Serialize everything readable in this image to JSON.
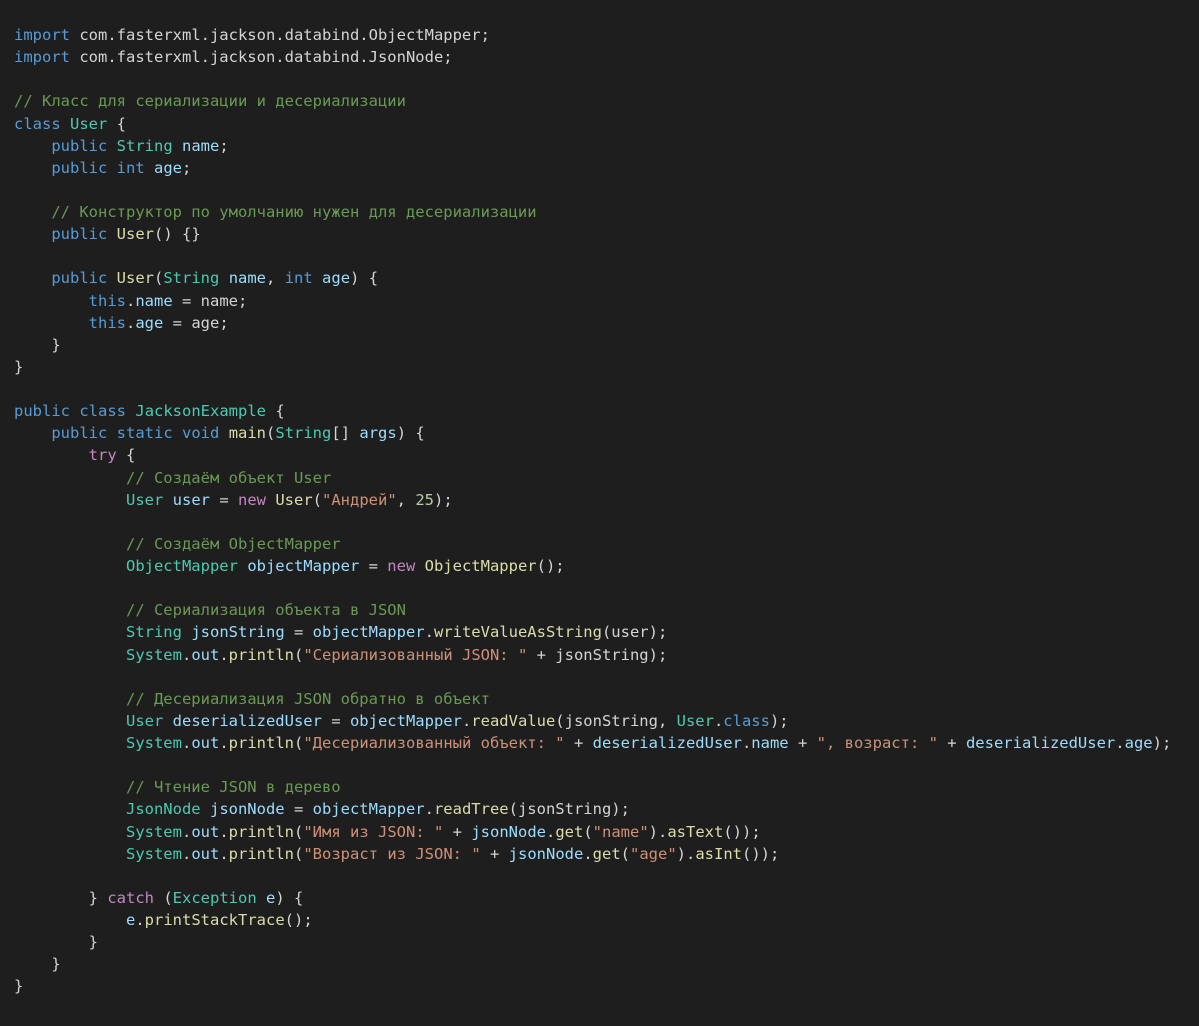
{
  "colors": {
    "background": "#1e1e1e",
    "kw": "#569cd6",
    "ctrl": "#c586c0",
    "type": "#4ec9b0",
    "var": "#9cdcfe",
    "fn": "#dcdcaa",
    "str": "#ce9178",
    "num": "#b5cea8",
    "cmt": "#6a9955",
    "plain": "#d4d4d4"
  },
  "code_lines": [
    [
      [
        "kw",
        "import"
      ],
      [
        "plain",
        " com.fasterxml.jackson.databind.ObjectMapper;"
      ]
    ],
    [
      [
        "kw",
        "import"
      ],
      [
        "plain",
        " com.fasterxml.jackson.databind.JsonNode;"
      ]
    ],
    [],
    [
      [
        "cmt",
        "// Класс для сериализации и десериализации"
      ]
    ],
    [
      [
        "kw",
        "class"
      ],
      [
        "plain",
        " "
      ],
      [
        "type",
        "User"
      ],
      [
        "plain",
        " {"
      ]
    ],
    [
      [
        "plain",
        "    "
      ],
      [
        "kw",
        "public"
      ],
      [
        "plain",
        " "
      ],
      [
        "type",
        "String"
      ],
      [
        "plain",
        " "
      ],
      [
        "var",
        "name"
      ],
      [
        "plain",
        ";"
      ]
    ],
    [
      [
        "plain",
        "    "
      ],
      [
        "kw",
        "public"
      ],
      [
        "plain",
        " "
      ],
      [
        "kw",
        "int"
      ],
      [
        "plain",
        " "
      ],
      [
        "var",
        "age"
      ],
      [
        "plain",
        ";"
      ]
    ],
    [],
    [
      [
        "plain",
        "    "
      ],
      [
        "cmt",
        "// Конструктор по умолчанию нужен для десериализации"
      ]
    ],
    [
      [
        "plain",
        "    "
      ],
      [
        "kw",
        "public"
      ],
      [
        "plain",
        " "
      ],
      [
        "fn",
        "User"
      ],
      [
        "plain",
        "() {}"
      ]
    ],
    [],
    [
      [
        "plain",
        "    "
      ],
      [
        "kw",
        "public"
      ],
      [
        "plain",
        " "
      ],
      [
        "fn",
        "User"
      ],
      [
        "plain",
        "("
      ],
      [
        "type",
        "String"
      ],
      [
        "plain",
        " "
      ],
      [
        "var",
        "name"
      ],
      [
        "plain",
        ", "
      ],
      [
        "kw",
        "int"
      ],
      [
        "plain",
        " "
      ],
      [
        "var",
        "age"
      ],
      [
        "plain",
        ") {"
      ]
    ],
    [
      [
        "plain",
        "        "
      ],
      [
        "kw",
        "this"
      ],
      [
        "plain",
        "."
      ],
      [
        "var",
        "name"
      ],
      [
        "plain",
        " = name;"
      ]
    ],
    [
      [
        "plain",
        "        "
      ],
      [
        "kw",
        "this"
      ],
      [
        "plain",
        "."
      ],
      [
        "var",
        "age"
      ],
      [
        "plain",
        " = age;"
      ]
    ],
    [
      [
        "plain",
        "    }"
      ]
    ],
    [
      [
        "plain",
        "}"
      ]
    ],
    [],
    [
      [
        "kw",
        "public"
      ],
      [
        "plain",
        " "
      ],
      [
        "kw",
        "class"
      ],
      [
        "plain",
        " "
      ],
      [
        "type",
        "JacksonExample"
      ],
      [
        "plain",
        " {"
      ]
    ],
    [
      [
        "plain",
        "    "
      ],
      [
        "kw",
        "public"
      ],
      [
        "plain",
        " "
      ],
      [
        "kw",
        "static"
      ],
      [
        "plain",
        " "
      ],
      [
        "kw",
        "void"
      ],
      [
        "plain",
        " "
      ],
      [
        "fn",
        "main"
      ],
      [
        "plain",
        "("
      ],
      [
        "type",
        "String"
      ],
      [
        "plain",
        "[] "
      ],
      [
        "var",
        "args"
      ],
      [
        "plain",
        ") {"
      ]
    ],
    [
      [
        "plain",
        "        "
      ],
      [
        "ctrl",
        "try"
      ],
      [
        "plain",
        " {"
      ]
    ],
    [
      [
        "plain",
        "            "
      ],
      [
        "cmt",
        "// Создаём объект User"
      ]
    ],
    [
      [
        "plain",
        "            "
      ],
      [
        "type",
        "User"
      ],
      [
        "plain",
        " "
      ],
      [
        "var",
        "user"
      ],
      [
        "plain",
        " = "
      ],
      [
        "ctrl",
        "new"
      ],
      [
        "plain",
        " "
      ],
      [
        "fn",
        "User"
      ],
      [
        "plain",
        "("
      ],
      [
        "str",
        "\"Андрей\""
      ],
      [
        "plain",
        ", "
      ],
      [
        "num",
        "25"
      ],
      [
        "plain",
        ");"
      ]
    ],
    [],
    [
      [
        "plain",
        "            "
      ],
      [
        "cmt",
        "// Создаём ObjectMapper"
      ]
    ],
    [
      [
        "plain",
        "            "
      ],
      [
        "type",
        "ObjectMapper"
      ],
      [
        "plain",
        " "
      ],
      [
        "var",
        "objectMapper"
      ],
      [
        "plain",
        " = "
      ],
      [
        "ctrl",
        "new"
      ],
      [
        "plain",
        " "
      ],
      [
        "fn",
        "ObjectMapper"
      ],
      [
        "plain",
        "();"
      ]
    ],
    [],
    [
      [
        "plain",
        "            "
      ],
      [
        "cmt",
        "// Сериализация объекта в JSON"
      ]
    ],
    [
      [
        "plain",
        "            "
      ],
      [
        "type",
        "String"
      ],
      [
        "plain",
        " "
      ],
      [
        "var",
        "jsonString"
      ],
      [
        "plain",
        " = "
      ],
      [
        "var",
        "objectMapper"
      ],
      [
        "plain",
        "."
      ],
      [
        "fn",
        "writeValueAsString"
      ],
      [
        "plain",
        "(user);"
      ]
    ],
    [
      [
        "plain",
        "            "
      ],
      [
        "type",
        "System"
      ],
      [
        "plain",
        "."
      ],
      [
        "var",
        "out"
      ],
      [
        "plain",
        "."
      ],
      [
        "fn",
        "println"
      ],
      [
        "plain",
        "("
      ],
      [
        "str",
        "\"Сериализованный JSON: \""
      ],
      [
        "plain",
        " + jsonString);"
      ]
    ],
    [],
    [
      [
        "plain",
        "            "
      ],
      [
        "cmt",
        "// Десериализация JSON обратно в объект"
      ]
    ],
    [
      [
        "plain",
        "            "
      ],
      [
        "type",
        "User"
      ],
      [
        "plain",
        " "
      ],
      [
        "var",
        "deserializedUser"
      ],
      [
        "plain",
        " = "
      ],
      [
        "var",
        "objectMapper"
      ],
      [
        "plain",
        "."
      ],
      [
        "fn",
        "readValue"
      ],
      [
        "plain",
        "(jsonString, "
      ],
      [
        "type",
        "User"
      ],
      [
        "plain",
        "."
      ],
      [
        "kw",
        "class"
      ],
      [
        "plain",
        ");"
      ]
    ],
    [
      [
        "plain",
        "            "
      ],
      [
        "type",
        "System"
      ],
      [
        "plain",
        "."
      ],
      [
        "var",
        "out"
      ],
      [
        "plain",
        "."
      ],
      [
        "fn",
        "println"
      ],
      [
        "plain",
        "("
      ],
      [
        "str",
        "\"Десериализованный объект: \""
      ],
      [
        "plain",
        " + "
      ],
      [
        "var",
        "deserializedUser"
      ],
      [
        "plain",
        "."
      ],
      [
        "var",
        "name"
      ],
      [
        "plain",
        " + "
      ],
      [
        "str",
        "\", возраст: \""
      ],
      [
        "plain",
        " + "
      ],
      [
        "var",
        "deserializedUser"
      ],
      [
        "plain",
        "."
      ],
      [
        "var",
        "age"
      ],
      [
        "plain",
        ");"
      ]
    ],
    [],
    [
      [
        "plain",
        "            "
      ],
      [
        "cmt",
        "// Чтение JSON в дерево"
      ]
    ],
    [
      [
        "plain",
        "            "
      ],
      [
        "type",
        "JsonNode"
      ],
      [
        "plain",
        " "
      ],
      [
        "var",
        "jsonNode"
      ],
      [
        "plain",
        " = "
      ],
      [
        "var",
        "objectMapper"
      ],
      [
        "plain",
        "."
      ],
      [
        "fn",
        "readTree"
      ],
      [
        "plain",
        "(jsonString);"
      ]
    ],
    [
      [
        "plain",
        "            "
      ],
      [
        "type",
        "System"
      ],
      [
        "plain",
        "."
      ],
      [
        "var",
        "out"
      ],
      [
        "plain",
        "."
      ],
      [
        "fn",
        "println"
      ],
      [
        "plain",
        "("
      ],
      [
        "str",
        "\"Имя из JSON: \""
      ],
      [
        "plain",
        " + "
      ],
      [
        "var",
        "jsonNode"
      ],
      [
        "plain",
        "."
      ],
      [
        "fn",
        "get"
      ],
      [
        "plain",
        "("
      ],
      [
        "str",
        "\"name\""
      ],
      [
        "plain",
        ")."
      ],
      [
        "fn",
        "asText"
      ],
      [
        "plain",
        "());"
      ]
    ],
    [
      [
        "plain",
        "            "
      ],
      [
        "type",
        "System"
      ],
      [
        "plain",
        "."
      ],
      [
        "var",
        "out"
      ],
      [
        "plain",
        "."
      ],
      [
        "fn",
        "println"
      ],
      [
        "plain",
        "("
      ],
      [
        "str",
        "\"Возраст из JSON: \""
      ],
      [
        "plain",
        " + "
      ],
      [
        "var",
        "jsonNode"
      ],
      [
        "plain",
        "."
      ],
      [
        "fn",
        "get"
      ],
      [
        "plain",
        "("
      ],
      [
        "str",
        "\"age\""
      ],
      [
        "plain",
        ")."
      ],
      [
        "fn",
        "asInt"
      ],
      [
        "plain",
        "());"
      ]
    ],
    [],
    [
      [
        "plain",
        "        } "
      ],
      [
        "ctrl",
        "catch"
      ],
      [
        "plain",
        " ("
      ],
      [
        "type",
        "Exception"
      ],
      [
        "plain",
        " "
      ],
      [
        "var",
        "e"
      ],
      [
        "plain",
        ") {"
      ]
    ],
    [
      [
        "plain",
        "            "
      ],
      [
        "var",
        "e"
      ],
      [
        "plain",
        "."
      ],
      [
        "fn",
        "printStackTrace"
      ],
      [
        "plain",
        "();"
      ]
    ],
    [
      [
        "plain",
        "        }"
      ]
    ],
    [
      [
        "plain",
        "    }"
      ]
    ],
    [
      [
        "plain",
        "}"
      ]
    ]
  ]
}
